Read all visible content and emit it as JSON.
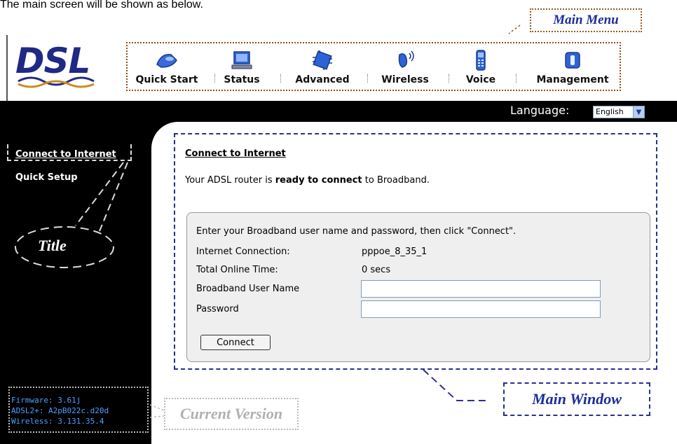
{
  "caption": "The main screen will be shown as below.",
  "annotations": {
    "main_menu": "Main Menu",
    "title": "Title",
    "current_version": "Current Version",
    "main_window": "Main Window"
  },
  "logo": {
    "text": "DSL"
  },
  "menu": {
    "items": [
      {
        "label": "Quick Start",
        "icon": "quick-start-icon"
      },
      {
        "label": "Status",
        "icon": "status-monitor-icon"
      },
      {
        "label": "Advanced",
        "icon": "advanced-chip-icon"
      },
      {
        "label": "Wireless",
        "icon": "wireless-icon"
      },
      {
        "label": "Voice",
        "icon": "voice-phone-icon"
      },
      {
        "label": "Management",
        "icon": "management-icon"
      }
    ]
  },
  "language": {
    "label": "Language:",
    "selected": "English"
  },
  "sidebar": {
    "title": "Connect to Internet",
    "items": [
      {
        "label": "Quick Setup"
      }
    ]
  },
  "versions": {
    "firmware": "Firmware: 3.61j",
    "adsl": "ADSL2+: A2pB022c.d20d",
    "wireless": "Wireless: 3.131.35.4"
  },
  "main": {
    "title": "Connect to Internet",
    "status_prefix": "Your ADSL router is ",
    "status_bold": "ready to connect",
    "status_suffix": " to Broadband.",
    "instructions": "Enter your Broadband user name and password, then click \"Connect\".",
    "rows": [
      {
        "label": "Internet Connection:",
        "value": "pppoe_8_35_1"
      },
      {
        "label": "Total Online Time:",
        "value": "0 secs"
      }
    ],
    "username_label": "Broadband User Name",
    "password_label": "Password",
    "username_value": "",
    "password_value": "",
    "connect_label": "Connect"
  },
  "colors": {
    "brand_blue": "#1f2a84",
    "annotation_blue": "#1c2d9a",
    "firmware_text": "#4ea0ff",
    "sidebar_bg": "#000000"
  }
}
